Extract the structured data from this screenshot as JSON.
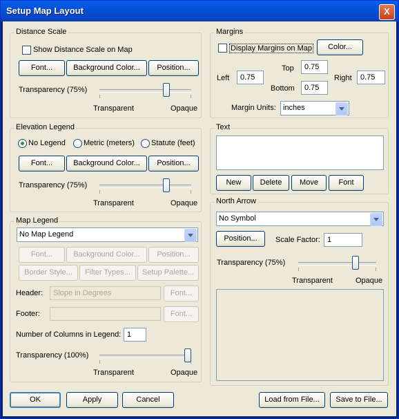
{
  "window": {
    "title": "Setup Map Layout",
    "close_label": "X"
  },
  "distance_scale": {
    "legend": "Distance Scale",
    "show_label": "Show Distance Scale on Map",
    "show_checked": false,
    "font_btn": "Font...",
    "bg_btn": "Background Color...",
    "pos_btn": "Position...",
    "transparency_label": "Transparency (75%)",
    "transparency_value": 0.75,
    "transparent_label": "Transparent",
    "opaque_label": "Opaque"
  },
  "elevation_legend": {
    "legend": "Elevation Legend",
    "radio_none": "No Legend",
    "radio_metric": "Metric (meters)",
    "radio_statute": "Statute (feet)",
    "selected": "none",
    "font_btn": "Font...",
    "bg_btn": "Background Color...",
    "pos_btn": "Position...",
    "transparency_label": "Transparency (75%)",
    "transparency_value": 0.75,
    "transparent_label": "Transparent",
    "opaque_label": "Opaque"
  },
  "map_legend": {
    "legend": "Map Legend",
    "combo_value": "No Map Legend",
    "font_btn": "Font...",
    "bg_btn": "Background Color...",
    "pos_btn": "Position...",
    "border_btn": "Border Style...",
    "filter_btn": "Filter Types...",
    "palette_btn": "Setup Palette...",
    "header_label": "Header:",
    "header_value": "Slope in Degrees",
    "header_font_btn": "Font...",
    "footer_label": "Footer:",
    "footer_value": "",
    "footer_font_btn": "Font...",
    "columns_label": "Number of Columns in Legend:",
    "columns_value": "1",
    "transparency_label": "Transparency (100%)",
    "transparency_value": 1.0,
    "transparent_label": "Transparent",
    "opaque_label": "Opaque"
  },
  "margins": {
    "legend": "Margins",
    "display_label": "Display Margins on Map",
    "display_checked": false,
    "color_btn": "Color...",
    "top_label": "Top",
    "top_value": "0.75",
    "left_label": "Left",
    "left_value": "0.75",
    "right_label": "Right",
    "right_value": "0.75",
    "bottom_label": "Bottom",
    "bottom_value": "0.75",
    "units_label": "Margin Units:",
    "units_value": "inches"
  },
  "text": {
    "legend": "Text",
    "new_btn": "New",
    "delete_btn": "Delete",
    "move_btn": "Move",
    "font_btn": "Font"
  },
  "north_arrow": {
    "legend": "North Arrow",
    "combo_value": "No Symbol",
    "pos_btn": "Position...",
    "scale_label": "Scale Factor:",
    "scale_value": "1",
    "transparency_label": "Transparency (75%)",
    "transparency_value": 0.75,
    "transparent_label": "Transparent",
    "opaque_label": "Opaque"
  },
  "footer": {
    "ok_btn": "OK",
    "apply_btn": "Apply",
    "cancel_btn": "Cancel",
    "load_btn": "Load from File...",
    "save_btn": "Save to File..."
  }
}
